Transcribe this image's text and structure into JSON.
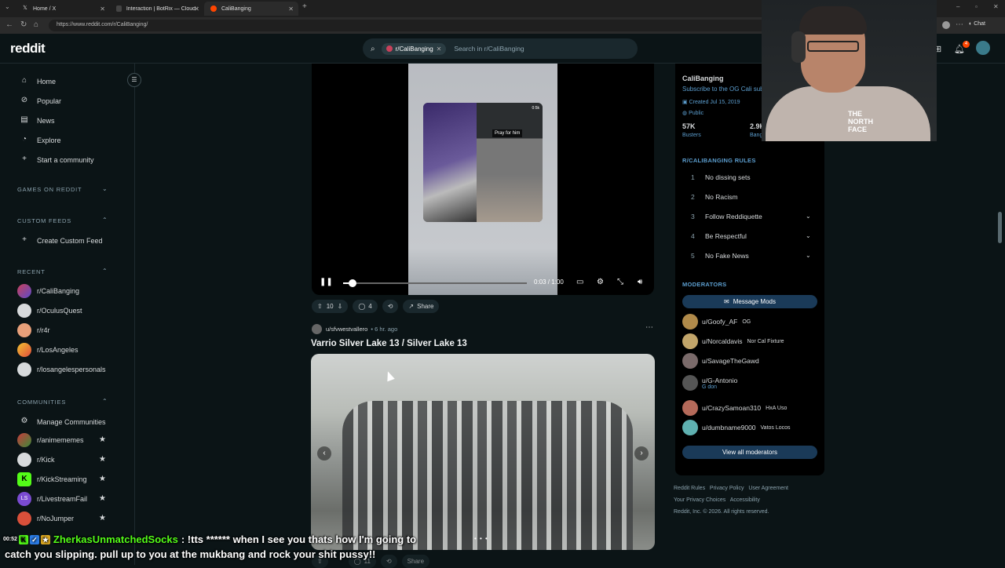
{
  "browser": {
    "tabs": [
      {
        "title": "Home / X",
        "icon": "x-logo-icon"
      },
      {
        "title": "Interaction | BotRix — Cloud Strea",
        "icon": "botrix-icon"
      },
      {
        "title": "CaliBanging",
        "icon": "reddit-icon"
      }
    ],
    "url": "https://www.reddit.com/r/CaliBanging/",
    "chat_button": "Chat"
  },
  "header": {
    "logo": "reddit",
    "search_chip": "r/CaliBanging",
    "search_placeholder": "Search in r/CaliBanging",
    "notification_count": "4"
  },
  "sidebar": {
    "nav": [
      {
        "label": "Home",
        "icon": "home-icon"
      },
      {
        "label": "Popular",
        "icon": "popular-icon"
      },
      {
        "label": "News",
        "icon": "news-icon"
      },
      {
        "label": "Explore",
        "icon": "explore-icon"
      },
      {
        "label": "Start a community",
        "icon": "plus-icon"
      }
    ],
    "games_heading": "GAMES ON REDDIT",
    "custom_feeds_heading": "CUSTOM FEEDS",
    "create_custom_feed": "Create Custom Feed",
    "recent_heading": "RECENT",
    "recent": [
      "r/CaliBanging",
      "r/OculusQuest",
      "r/r4r",
      "r/LosAngeles",
      "r/losangelespersonals"
    ],
    "communities_heading": "COMMUNITIES",
    "manage_communities": "Manage Communities",
    "communities": [
      "r/animememes",
      "r/Kick",
      "r/KickStreaming",
      "r/LivestreamFail",
      "r/NoJumper"
    ]
  },
  "video_post": {
    "overlay_label": "Pray for him",
    "overlay_small": "0:5k",
    "time": "0:03 / 1:00",
    "progress": 0.05,
    "upvotes": "10",
    "comments": "4",
    "share": "Share"
  },
  "post": {
    "user": "u/sfvwestvallero",
    "time": "• 6 hr. ago",
    "title": "Varrio Silver Lake 13 / Silver Lake 13",
    "carousel_dots": "• • •",
    "comments": "11",
    "share": "Share"
  },
  "rail": {
    "name": "CaliBanging",
    "tagline": "Subscribe to the OG Cali sub",
    "created": "Created Jul 15, 2019",
    "visibility": "Public",
    "stat1_value": "57K",
    "stat1_label": "Busters",
    "stat2_value": "2.9K",
    "stat2_label": "Bang",
    "rules_heading": "R/CALIBANGING RULES",
    "rules": [
      {
        "n": "1",
        "text": "No dissing sets",
        "expand": false
      },
      {
        "n": "2",
        "text": "No Racism",
        "expand": false
      },
      {
        "n": "3",
        "text": "Follow Reddiquette",
        "expand": true
      },
      {
        "n": "4",
        "text": "Be Respectful",
        "expand": true
      },
      {
        "n": "5",
        "text": "No Fake News",
        "expand": true
      }
    ],
    "mods_heading": "MODERATORS",
    "message_mods": "Message Mods",
    "mods": [
      {
        "name": "u/Goofy_AF",
        "flair": "OG",
        "sub": ""
      },
      {
        "name": "u/Norcaldavis",
        "flair": "Nor Cal Fixture",
        "sub": ""
      },
      {
        "name": "u/SavageTheGawd",
        "flair": "",
        "sub": ""
      },
      {
        "name": "u/G-Antonio",
        "flair": "",
        "sub": "G don"
      },
      {
        "name": "u/CrazySamoan310",
        "flair": "HxA Uso",
        "sub": ""
      },
      {
        "name": "u/dumbname9000",
        "flair": "Vatos Locos",
        "sub": ""
      }
    ],
    "view_all_mods": "View all moderators",
    "footer_line1": [
      "Reddit Rules",
      "Privacy Policy",
      "User Agreement"
    ],
    "footer_line2": [
      "Your Privacy Choices",
      "Accessibility"
    ],
    "footer_copyright": "Reddit, Inc. © 2026. All rights reserved."
  },
  "chat": {
    "timestamp": "00:52",
    "username": "ZherkasUnmatchedSocks",
    "line1": ": !tts ****** when I see you thats how I'm going to",
    "line2": "catch you slipping. pull up to you at the mukbang and rock your shit pussy!!"
  },
  "webcam": {
    "shirt_text": "THE NORTH FACE"
  }
}
